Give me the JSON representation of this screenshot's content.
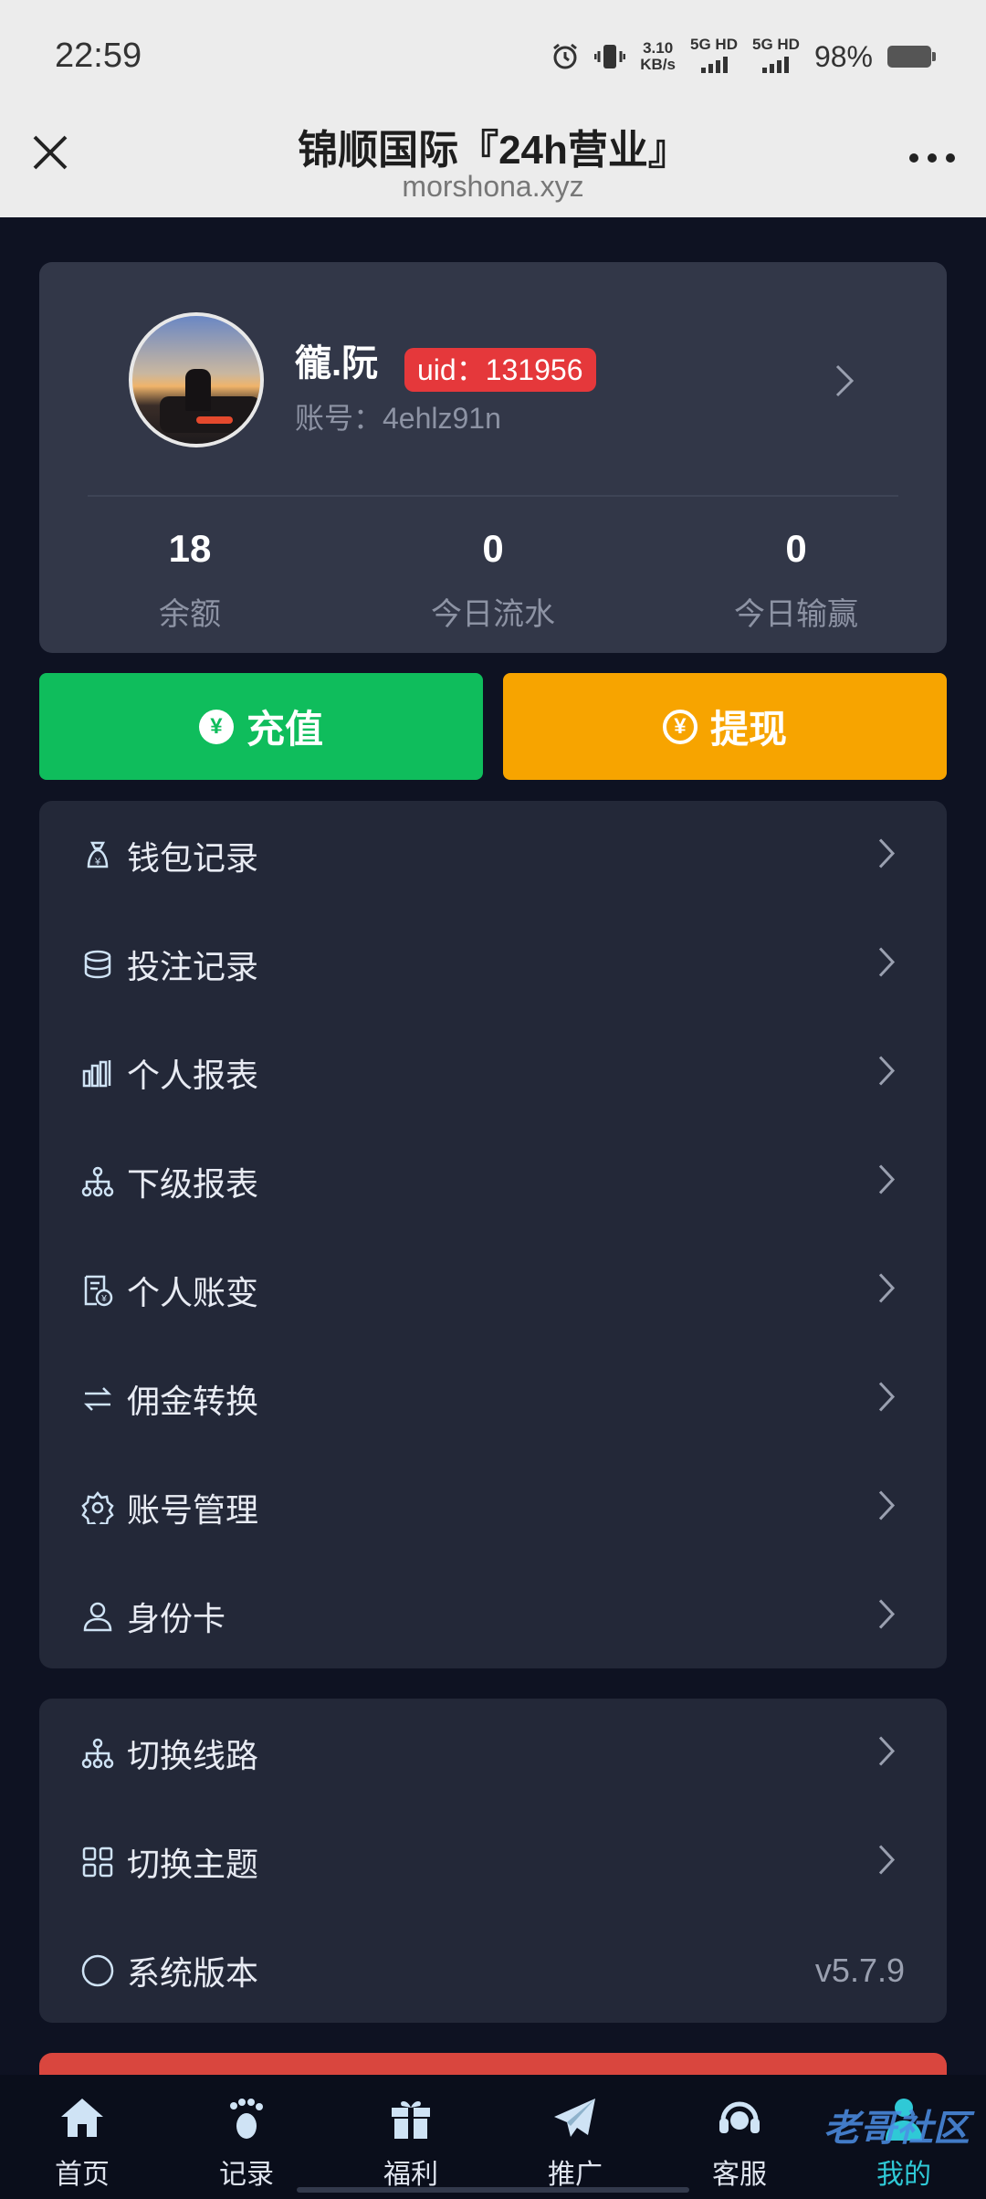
{
  "status_bar": {
    "time": "22:59",
    "net_speed": "3.10",
    "net_unit": "KB/s",
    "sim1": "5G HD",
    "sim2": "5G HD",
    "battery": "98%"
  },
  "browser": {
    "title": "锦顺国际『24h营业』",
    "domain": "morshona.xyz"
  },
  "profile": {
    "nickname": "徿.阮",
    "uid": "uid：131956",
    "account": "账号：4ehlz91n",
    "stats": [
      {
        "value": "18",
        "label": "余额"
      },
      {
        "value": "0",
        "label": "今日流水"
      },
      {
        "value": "0",
        "label": "今日输赢"
      }
    ]
  },
  "actions": {
    "recharge": "充值",
    "withdraw": "提现"
  },
  "menu_main": [
    {
      "label": "钱包记录",
      "icon": "wallet-icon"
    },
    {
      "label": "投注记录",
      "icon": "stack-icon"
    },
    {
      "label": "个人报表",
      "icon": "bar-chart-icon"
    },
    {
      "label": "下级报表",
      "icon": "hierarchy-icon"
    },
    {
      "label": "个人账变",
      "icon": "bill-icon"
    },
    {
      "label": "佣金转换",
      "icon": "swap-icon"
    },
    {
      "label": "账号管理",
      "icon": "gear-icon"
    },
    {
      "label": "身份卡",
      "icon": "user-icon"
    }
  ],
  "menu_system": [
    {
      "label": "切换线路",
      "icon": "hierarchy-icon"
    },
    {
      "label": "切换主题",
      "icon": "grid-icon"
    },
    {
      "label": "系统版本",
      "icon": "circle-icon",
      "value": "v5.7.9"
    }
  ],
  "tabs": [
    {
      "label": "首页",
      "icon": "home-icon"
    },
    {
      "label": "记录",
      "icon": "footprint-icon"
    },
    {
      "label": "福利",
      "icon": "gift-icon"
    },
    {
      "label": "推广",
      "icon": "paper-plane-icon"
    },
    {
      "label": "客服",
      "icon": "headset-icon"
    },
    {
      "label": "我的",
      "icon": "person-icon",
      "active": true
    }
  ],
  "watermark": "老哥社区",
  "colors": {
    "green": "#0fbd5c",
    "orange": "#f7a400",
    "uid_red": "#e5383b",
    "accent": "#2fc9d6"
  }
}
